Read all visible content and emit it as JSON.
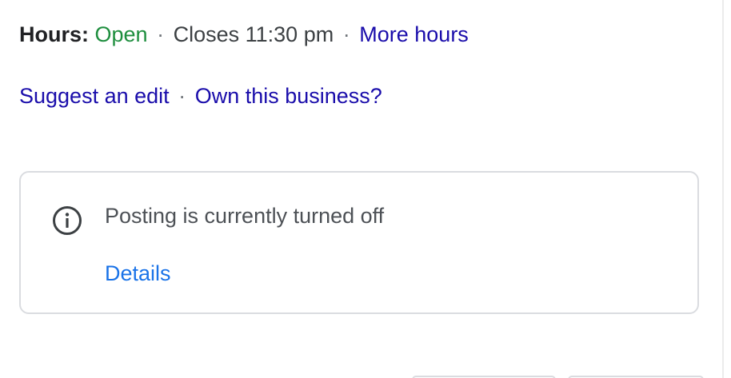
{
  "hours": {
    "label": "Hours:",
    "status": "Open",
    "separator": "·",
    "closes_text": "Closes 11:30 pm",
    "more_hours_link": "More hours"
  },
  "business_links": {
    "suggest_edit": "Suggest an edit",
    "separator": "·",
    "own_business": "Own this business?"
  },
  "posting_notice": {
    "icon": "info-icon",
    "message": "Posting is currently turned off",
    "details_link": "Details"
  },
  "colors": {
    "open_status": "#1e8e3e",
    "link": "#1a0dab",
    "details_link": "#1a73e8"
  }
}
